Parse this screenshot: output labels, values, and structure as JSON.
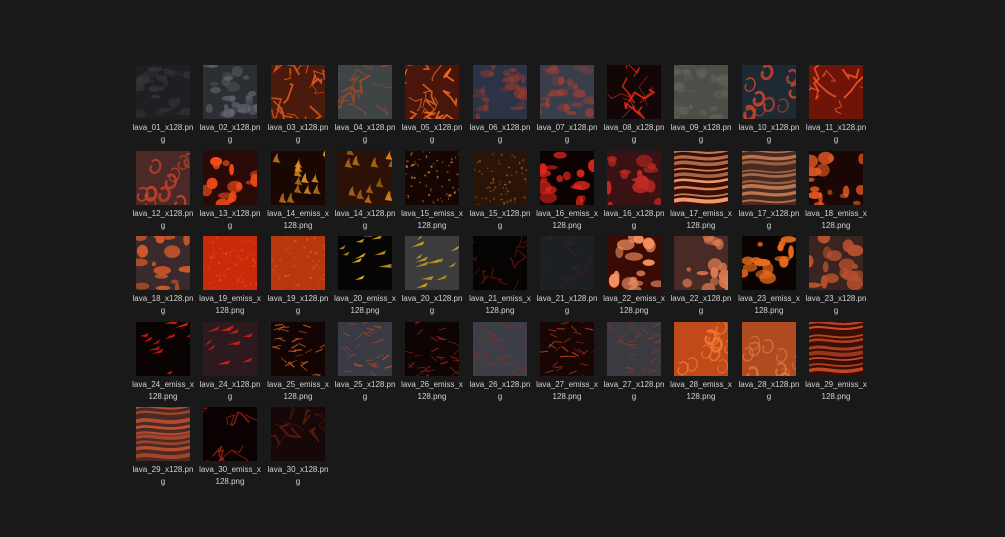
{
  "files": [
    {
      "name": "lava_01_x128.png",
      "base": "#1e1f22",
      "vein": "#3a3b3f",
      "style": "rock"
    },
    {
      "name": "lava_02_x128.png",
      "base": "#2b2e33",
      "vein": "#6a6e74",
      "style": "rock"
    },
    {
      "name": "lava_03_x128.png",
      "base": "#4a1b0c",
      "vein": "#e0581e",
      "style": "veins"
    },
    {
      "name": "lava_04_x128.png",
      "base": "#3f4546",
      "vein": "#9c4a2a",
      "style": "veins"
    },
    {
      "name": "lava_05_x128.png",
      "base": "#4a150a",
      "vein": "#ee6a28",
      "style": "veins"
    },
    {
      "name": "lava_06_x128.png",
      "base": "#2a3446",
      "vein": "#a43a2c",
      "style": "rock"
    },
    {
      "name": "lava_07_x128.png",
      "base": "#3a3e4a",
      "vein": "#b34030",
      "style": "rock"
    },
    {
      "name": "lava_08_x128.png",
      "base": "#120607",
      "vein": "#e62a14",
      "style": "cracks"
    },
    {
      "name": "lava_09_x128.png",
      "base": "#4b4f47",
      "vein": "#62665c",
      "style": "rock"
    },
    {
      "name": "lava_10_x128.png",
      "base": "#1d2a33",
      "vein": "#c2422c",
      "style": "swirl"
    },
    {
      "name": "lava_11_x128.png",
      "base": "#701408",
      "vein": "#f2582a",
      "style": "cracks"
    },
    {
      "name": "lava_12_x128.png",
      "base": "#4a2a26",
      "vein": "#c2402a",
      "style": "swirl"
    },
    {
      "name": "lava_13_x128.png",
      "base": "#2a0a06",
      "vein": "#f04a18",
      "style": "blobs"
    },
    {
      "name": "lava_14_emiss_x128.png",
      "base": "#1a0702",
      "vein": "#f09a22",
      "style": "flames"
    },
    {
      "name": "lava_14_x128.png",
      "base": "#2c1206",
      "vein": "#d0801e",
      "style": "flames"
    },
    {
      "name": "lava_15_emiss_x128.png",
      "base": "#160603",
      "vein": "#d87020",
      "style": "specks"
    },
    {
      "name": "lava_15_x128.png",
      "base": "#2a1408",
      "vein": "#9a5a20",
      "style": "specks"
    },
    {
      "name": "lava_16_emiss_x128.png",
      "base": "#0c0202",
      "vein": "#e0281c",
      "style": "blobs"
    },
    {
      "name": "lava_16_x128.png",
      "base": "#3a1214",
      "vein": "#c02a22",
      "style": "blobs"
    },
    {
      "name": "lava_17_emiss_x128.png",
      "base": "#3a0e04",
      "vein": "#f2a070",
      "style": "waves"
    },
    {
      "name": "lava_17_x128.png",
      "base": "#4a2a1e",
      "vein": "#c8805a",
      "style": "waves"
    },
    {
      "name": "lava_18_emiss_x128.png",
      "base": "#1a0604",
      "vein": "#e85a24",
      "style": "blobs"
    },
    {
      "name": "lava_18_x128.png",
      "base": "#3a2a2c",
      "vein": "#d2582a",
      "style": "blobs"
    },
    {
      "name": "lava_19_emiss_x128.png",
      "base": "#c82a0a",
      "vein": "#ee4a14",
      "style": "specks"
    },
    {
      "name": "lava_19_x128.png",
      "base": "#b8380e",
      "vein": "#e4561c",
      "style": "specks"
    },
    {
      "name": "lava_20_emiss_x128.png",
      "base": "#060404",
      "vein": "#e0b01c",
      "style": "streaks"
    },
    {
      "name": "lava_20_x128.png",
      "base": "#3c3c3e",
      "vein": "#d2a81e",
      "style": "streaks"
    },
    {
      "name": "lava_21_emiss_x128.png",
      "base": "#060303",
      "vein": "#5a1208",
      "style": "cracks"
    },
    {
      "name": "lava_21_x128.png",
      "base": "#1c2024",
      "vein": "#3a2224",
      "style": "cracks"
    },
    {
      "name": "lava_22_emiss_x128.png",
      "base": "#3a0a04",
      "vein": "#f59060",
      "style": "blobs"
    },
    {
      "name": "lava_22_x128.png",
      "base": "#4a2a26",
      "vein": "#e07a50",
      "style": "blobs"
    },
    {
      "name": "lava_23_emiss_x128.png",
      "base": "#0a0302",
      "vein": "#ea6a1a",
      "style": "blobs"
    },
    {
      "name": "lava_23_x128.png",
      "base": "#3a2420",
      "vein": "#b8502e",
      "style": "blobs"
    },
    {
      "name": "lava_24_emiss_x128.png",
      "base": "#080202",
      "vein": "#ea1a12",
      "style": "streaks"
    },
    {
      "name": "lava_24_x128.png",
      "base": "#2c1a1e",
      "vein": "#d8201c",
      "style": "streaks"
    },
    {
      "name": "lava_25_emiss_x128.png",
      "base": "#120403",
      "vein": "#c05a24",
      "style": "fibers"
    },
    {
      "name": "lava_25_x128.png",
      "base": "#3a3a44",
      "vein": "#b24a22",
      "style": "fibers"
    },
    {
      "name": "lava_26_emiss_x128.png",
      "base": "#0e0403",
      "vein": "#b02818",
      "style": "fibers"
    },
    {
      "name": "lava_26_x128.png",
      "base": "#3c3e48",
      "vein": "#9a2a20",
      "style": "fibers"
    },
    {
      "name": "lava_27_emiss_x128.png",
      "base": "#180604",
      "vein": "#b43a1c",
      "style": "fibers"
    },
    {
      "name": "lava_27_x128.png",
      "base": "#3a3a40",
      "vein": "#8e3a26",
      "style": "fibers"
    },
    {
      "name": "lava_28_emiss_x128.png",
      "base": "#c04a1a",
      "vein": "#f07a30",
      "style": "swirl"
    },
    {
      "name": "lava_28_x128.png",
      "base": "#b04a20",
      "vein": "#e0763a",
      "style": "swirl"
    },
    {
      "name": "lava_29_emiss_x128.png",
      "base": "#3a0e06",
      "vein": "#d0502a",
      "style": "waves"
    },
    {
      "name": "lava_29_x128.png",
      "base": "#4a2a24",
      "vein": "#c8502e",
      "style": "waves"
    },
    {
      "name": "lava_30_emiss_x128.png",
      "base": "#0a0202",
      "vein": "#a8200e",
      "style": "cracks"
    },
    {
      "name": "lava_30_x128.png",
      "base": "#160808",
      "vein": "#5a1a10",
      "style": "cracks"
    }
  ]
}
